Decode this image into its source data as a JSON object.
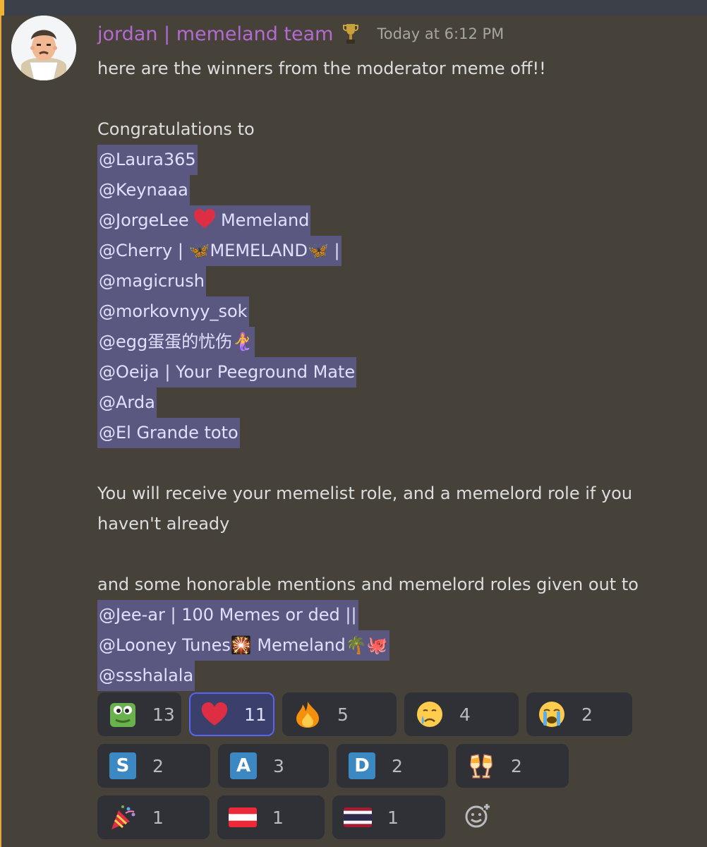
{
  "message": {
    "username": "jordan | memeland team",
    "timestamp": "Today at 6:12 PM",
    "intro": "here are the winners from the moderator meme off!!",
    "congrats": "Congratulations to",
    "winners": [
      {
        "text": "@Laura365"
      },
      {
        "text": "@Keynaaa"
      },
      {
        "pre": "@JorgeLee ",
        "post": " Memeland",
        "emoji": "heart"
      },
      {
        "text": "@Cherry | 🦋MEMELAND🦋 |"
      },
      {
        "text": "@magicrush"
      },
      {
        "text": "@morkovnyy_sok"
      },
      {
        "text": "@egg蛋蛋的忧伤🧜‍♀️"
      },
      {
        "text": "@Oeija | Your Peeground Mate"
      },
      {
        "text": "@Arda"
      },
      {
        "text": "@El Grande toto"
      }
    ],
    "receive": "You will receive your memelist role, and a memelord role if you haven't already",
    "honorable_intro": "and some honorable mentions and memelord roles given out to",
    "honorable": [
      {
        "text": "@Jee-ar | 100 Memes or ded ||"
      },
      {
        "text": "@Looney Tunes🎇 Memeland🌴🐙"
      },
      {
        "text": "@ssshalala"
      }
    ]
  },
  "reactions": [
    {
      "icon": "frog-emoji-icon",
      "count": "13",
      "active": false
    },
    {
      "icon": "heart-emoji-icon",
      "count": "11",
      "active": true
    },
    {
      "icon": "fire-emoji-icon",
      "count": "5",
      "active": false
    },
    {
      "icon": "crying-face-emoji-icon",
      "count": "4",
      "active": false
    },
    {
      "icon": "loudly-crying-face-emoji-icon",
      "count": "2",
      "active": false
    },
    {
      "icon": "letter-s-icon",
      "letter": "S",
      "count": "2",
      "active": false
    },
    {
      "icon": "letter-a-icon",
      "letter": "A",
      "count": "3",
      "active": false
    },
    {
      "icon": "letter-d-icon",
      "letter": "D",
      "count": "2",
      "active": false
    },
    {
      "icon": "champagne-glasses-emoji-icon",
      "count": "2",
      "active": false
    },
    {
      "icon": "party-popper-emoji-icon",
      "count": "1",
      "active": false
    },
    {
      "icon": "austria-flag-icon",
      "count": "1",
      "active": false
    },
    {
      "icon": "thailand-flag-icon",
      "count": "1",
      "active": false
    }
  ],
  "colors": {
    "background": "#464139",
    "username": "#b36bd1",
    "mention_bg": "#5a5880",
    "reaction_bg": "#2f3136",
    "reaction_active_border": "#5865f2"
  }
}
